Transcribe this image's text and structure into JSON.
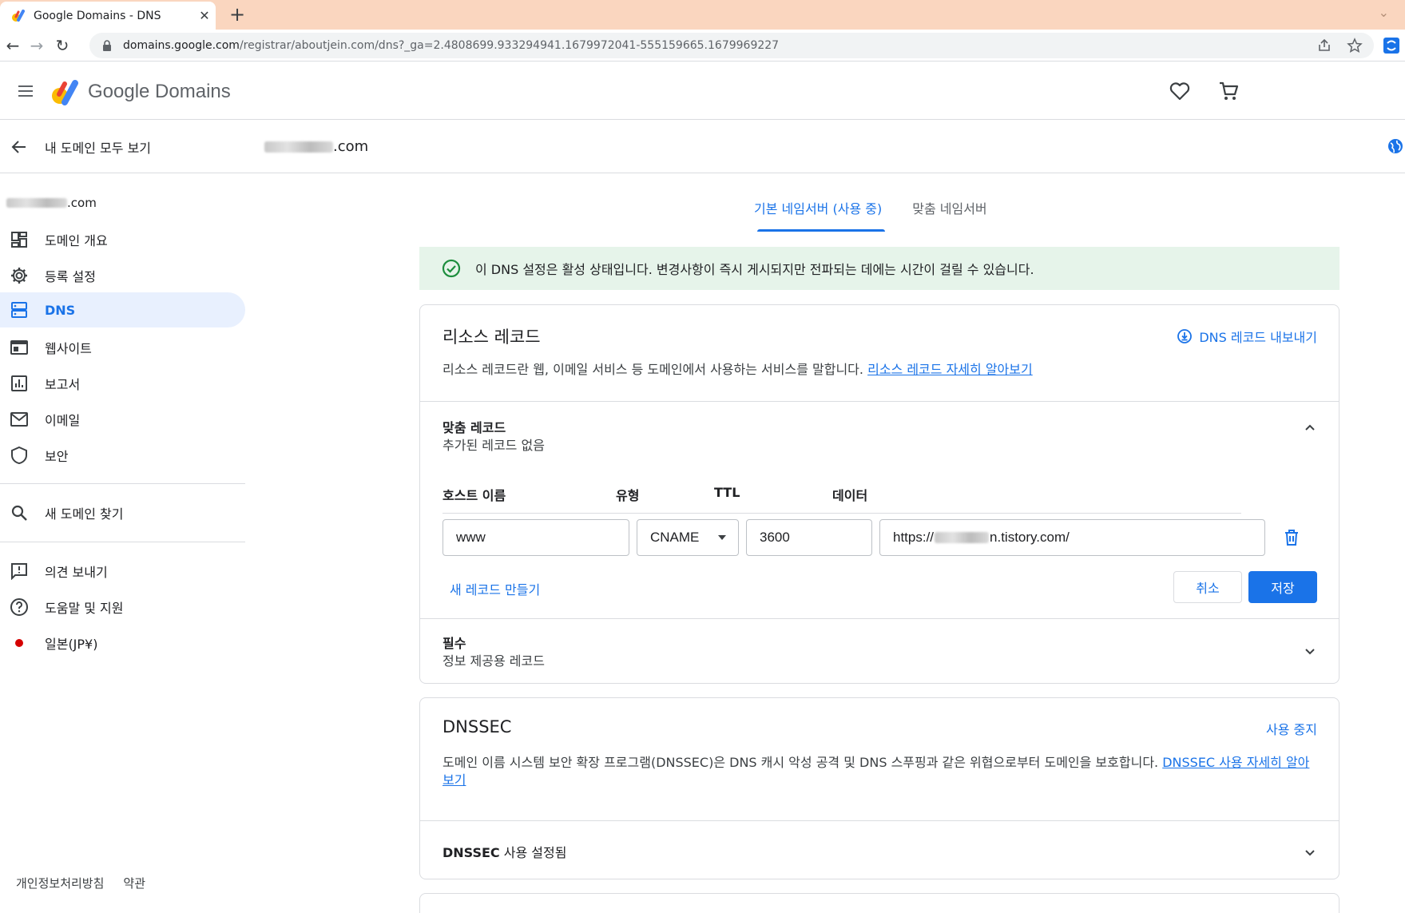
{
  "browser": {
    "tab_title": "Google Domains - DNS",
    "url_host": "domains.google.com",
    "url_rest": "/registrar/aboutjein.com/dns?_ga=2.4808699.933294941.1679972041-555159665.1679969227"
  },
  "header": {
    "logo_text": "Google Domains"
  },
  "sidebar": {
    "back_label": "내 도메인 모두 보기",
    "domain_suffix": ".com",
    "items": [
      {
        "label": "도메인 개요",
        "icon": "dashboard-icon"
      },
      {
        "label": "등록 설정",
        "icon": "gear-icon"
      },
      {
        "label": "DNS",
        "icon": "dns-icon",
        "active": true
      },
      {
        "label": "웹사이트",
        "icon": "web-icon"
      },
      {
        "label": "보고서",
        "icon": "chart-icon"
      },
      {
        "label": "이메일",
        "icon": "mail-icon"
      },
      {
        "label": "보안",
        "icon": "shield-icon"
      }
    ],
    "find_domain": "새 도메인 찾기",
    "feedback": "의견 보내기",
    "help": "도움말 및 지원",
    "region": "일본(JP¥)",
    "footer": {
      "privacy": "개인정보처리방침",
      "terms": "약관"
    }
  },
  "domainbar": {
    "domain_suffix": ".com"
  },
  "ns_tabs": {
    "default": "기본 네임서버 (사용 중)",
    "custom": "맞춤 네임서버"
  },
  "banner": {
    "message": "이 DNS 설정은 활성 상태입니다. 변경사항이 즉시 게시되지만 전파되는 데에는 시간이 걸릴 수 있습니다."
  },
  "resource_records": {
    "title": "리소스 레코드",
    "export_label": "DNS 레코드 내보내기",
    "description": "리소스 레코드란 웹, 이메일 서비스 등 도메인에서 사용하는 서비스를 말합니다.",
    "learn_more": "리소스 레코드 자세히 알아보기",
    "custom": {
      "title": "맞춤 레코드",
      "subtitle": "추가된 레코드 없음",
      "columns": {
        "host": "호스트 이름",
        "type": "유형",
        "ttl": "TTL",
        "data": "데이터"
      },
      "row": {
        "host": "www",
        "type": "CNAME",
        "ttl": "3600",
        "data_prefix": "https://",
        "data_suffix": "n.tistory.com/"
      },
      "add_record": "새 레코드 만들기",
      "cancel": "취소",
      "save": "저장"
    },
    "required": {
      "title": "필수",
      "subtitle": "정보 제공용 레코드"
    }
  },
  "dnssec": {
    "title": "DNSSEC",
    "action": "사용 중지",
    "description": "도메인 이름 시스템 보안 확장 프로그램(DNSSEC)은 DNS 캐시 악성 공격 및 DNS 스푸핑과 같은 위협으로부터 도메인을 보호합니다.",
    "learn_more": "DNSSEC 사용 자세히 알아보기",
    "status": "DNSSEC",
    "status_suffix": "사용 설정됨"
  },
  "colors": {
    "accent": "#1a73e8",
    "banner_bg": "#e6f4ea",
    "success": "#1e8e3e",
    "active_nav": "#e8f0fe"
  }
}
